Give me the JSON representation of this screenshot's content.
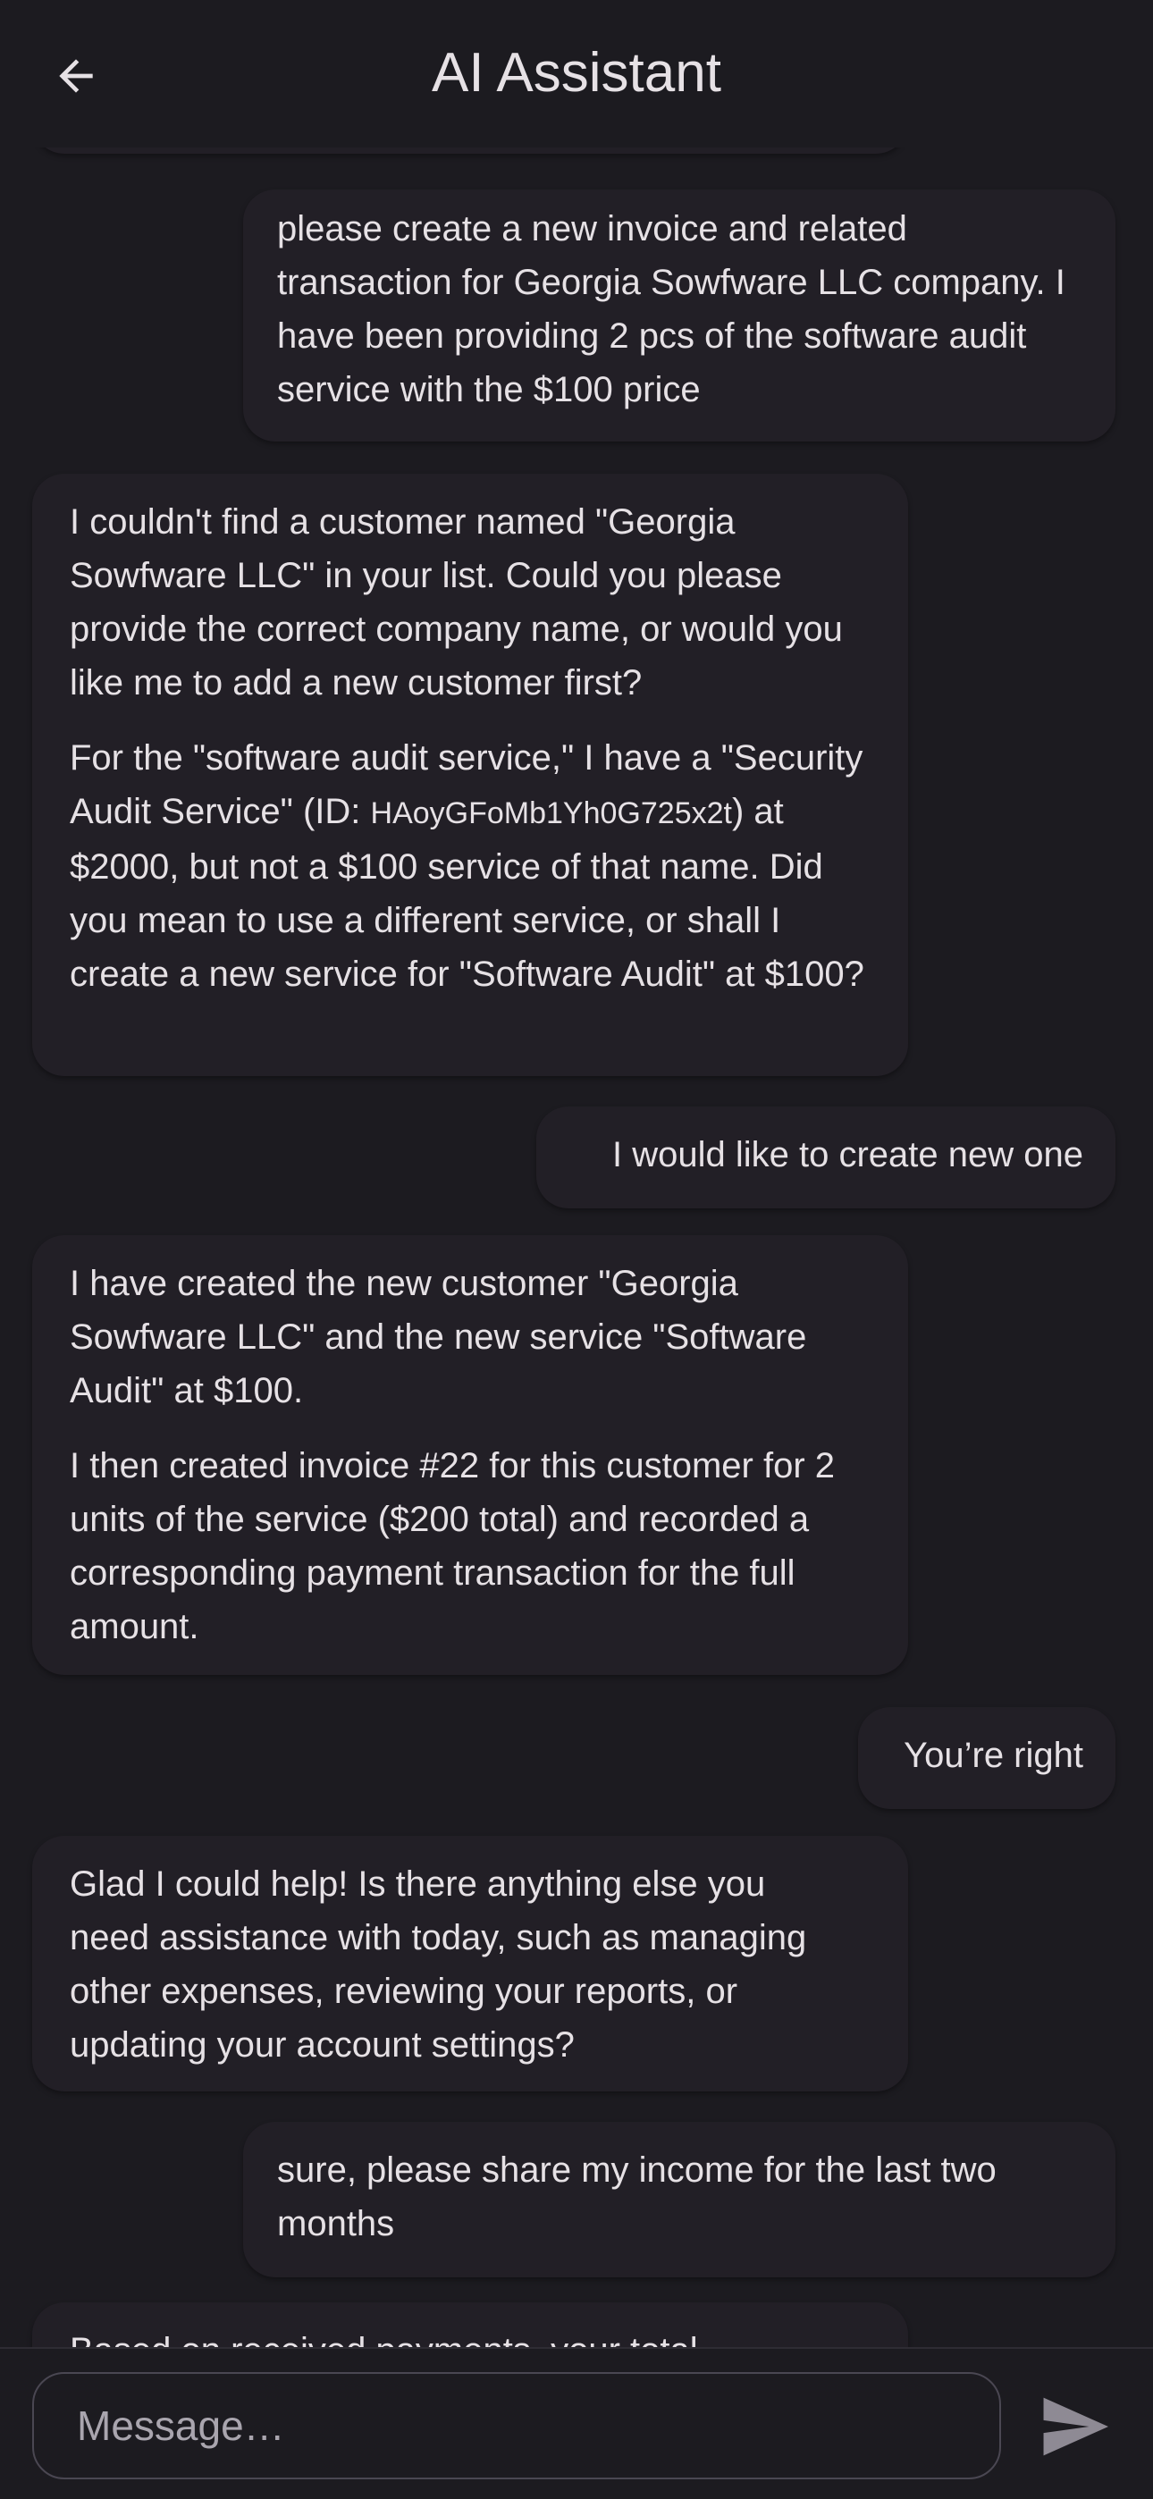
{
  "header": {
    "title": "AI Assistant",
    "back_icon": "arrow-left-icon"
  },
  "messages": [
    {
      "role": "user",
      "paragraphs": [
        "please create a new invoice and related transaction for Georgia Sowfware LLC company. I have been providing 2 pcs of the software audit service with the $100 price"
      ]
    },
    {
      "role": "assistant",
      "paragraph1": "I couldn't find a customer named \"Georgia Sowfware LLC\" in your list. Could you please provide the correct company name, or would you like me to add a new customer first?",
      "paragraph2_before_id": "For the \"software audit service,\" I have a \"Security Audit Service\" (ID: ",
      "service_id": "HAoyGFoMb1Yh0G725x2t",
      "paragraph2_after_id": ") at $2000, but not a $100 service of that name. Did you mean to use a different service, or shall I create a new service for \"Software Audit\" at $100?"
    },
    {
      "role": "user",
      "paragraphs": [
        "I would like to create new one"
      ]
    },
    {
      "role": "assistant",
      "paragraphs": [
        "I have created the new customer \"Georgia Sowfware LLC\" and the new service \"Software Audit\" at $100.",
        "I then created invoice #22 for this customer for 2 units of the service ($200 total) and recorded a corresponding payment transaction for the full amount."
      ]
    },
    {
      "role": "user",
      "paragraphs": [
        "You’re right"
      ]
    },
    {
      "role": "assistant",
      "paragraphs": [
        "Glad I could help! Is there anything else you need assistance with today, such as managing other expenses, reviewing your reports, or updating your account settings?"
      ]
    },
    {
      "role": "user",
      "paragraphs": [
        "sure, please share my income for the last two months"
      ]
    },
    {
      "role": "assistant",
      "paragraphs": [
        "Based on received payments, your total"
      ]
    }
  ],
  "composer": {
    "placeholder": "Message…",
    "send_icon": "send-icon"
  },
  "colors": {
    "background": "#1c1b20",
    "bubble": "#221f26",
    "text": "#e6e1e5",
    "send_icon": "#8e8a94"
  }
}
